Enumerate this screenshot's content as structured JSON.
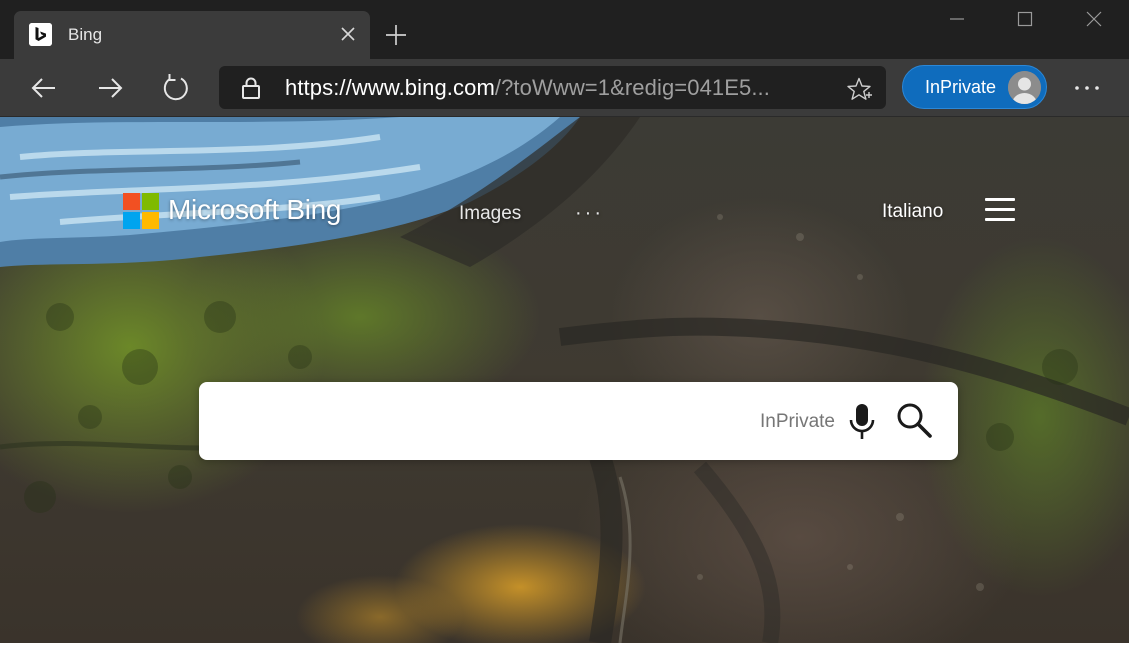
{
  "browser": {
    "tab": {
      "title": "Bing"
    },
    "address_bar": {
      "url_prefix": "https://",
      "url_host": "www.bing.com",
      "url_rest": "/?toWww=1&redig=041E5..."
    },
    "profile": {
      "label": "InPrivate"
    }
  },
  "page": {
    "logo_text": "Microsoft Bing",
    "nav": {
      "images": "Images",
      "more": "···"
    },
    "language": "Italiano",
    "search": {
      "value": "",
      "hint": "InPrivate"
    }
  },
  "colors": {
    "inprivate_blue": "#0f6cbd",
    "chrome_dark": "#202020",
    "toolbar": "#3b3b3b",
    "logo_red": "#f25022",
    "logo_green": "#7fba00",
    "logo_blue": "#00a4ef",
    "logo_yellow": "#ffb900"
  },
  "icons": [
    "bing-favicon-icon",
    "close-icon",
    "plus-icon",
    "minimize-icon",
    "maximize-icon",
    "window-close-icon",
    "back-arrow-icon",
    "forward-arrow-icon",
    "refresh-icon",
    "lock-icon",
    "favorite-star-icon",
    "avatar",
    "more-icon",
    "microsoft-logo-icon",
    "hamburger-menu-icon",
    "microphone-icon",
    "search-icon"
  ]
}
